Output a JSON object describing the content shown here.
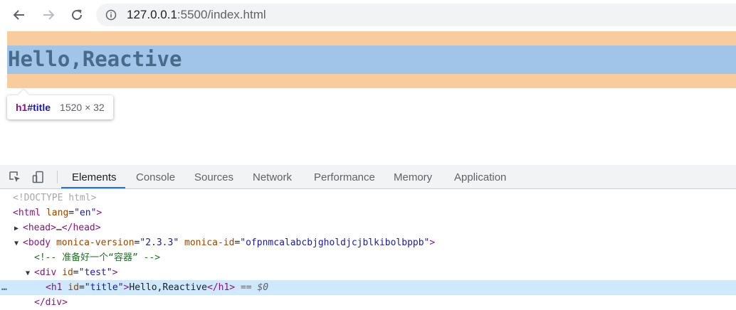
{
  "browser": {
    "url_host": "127.0.0.1",
    "url_path": ":5500/index.html",
    "icons": [
      "back-arrow-icon",
      "forward-arrow-icon",
      "reload-icon",
      "info-icon"
    ]
  },
  "page": {
    "h1_text": "Hello,Reactive",
    "tooltip_tag": "h1",
    "tooltip_id": "#title",
    "tooltip_size": "1520 × 32"
  },
  "devtools": {
    "tabs": [
      "Elements",
      "Console",
      "Sources",
      "Network",
      "Performance",
      "Memory",
      "Application"
    ],
    "active_tab": "Elements",
    "dom": {
      "doctype": "<!DOCTYPE html>",
      "html_open_tag": "<html",
      "html_lang_attr": " lang",
      "html_lang_val": "\"en\"",
      "html_close_bracket": ">",
      "head_tag": "<head>",
      "head_ellipsis": "…",
      "head_close": "</head>",
      "body_tag": "<body",
      "body_attr1": " monica-version",
      "body_val1": "\"2.3.3\"",
      "body_attr2": " monica-id",
      "body_val2": "\"ofpnmcalabcbjgholdjcjblkibolbppb\"",
      "body_close_bracket": ">",
      "comment": "<!-- 准备好一个“容器” -->",
      "div_tag": "<div",
      "div_attr": " id",
      "div_val": "\"test\"",
      "div_close_bracket": ">",
      "h1_tag": "<h1",
      "h1_attr": " id",
      "h1_val": "\"title\"",
      "h1_gt": ">",
      "h1_text": "Hello,Reactive",
      "h1_close": "</h1>",
      "selected_marker": " == $0",
      "div_close": "</div>",
      "dots": "…",
      "equals": "="
    }
  },
  "colors": {
    "margin_highlight": "#f9cc9d",
    "content_highlight": "#a0c5e8",
    "selected_row": "#cfe8fc",
    "tab_accent": "#1a73e8"
  }
}
